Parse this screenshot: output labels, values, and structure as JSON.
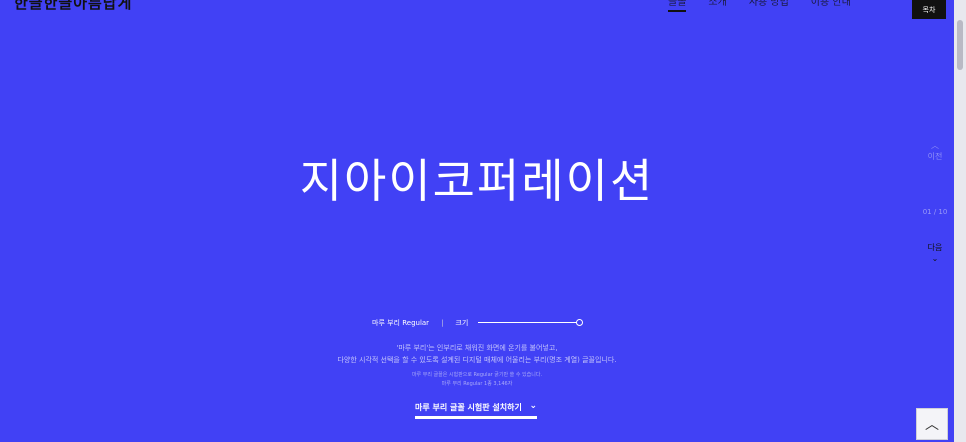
{
  "logo": "한글한글아름답게",
  "nav": [
    "글꼴",
    "소개",
    "사용 방법",
    "이용 안내"
  ],
  "toc_label": "목차",
  "headline": "지아이코퍼레이션",
  "side_up": {
    "arrow": "^",
    "label": "이전"
  },
  "counter": "01 / 10",
  "side_down": {
    "label": "다음",
    "arrow": "v"
  },
  "controls": {
    "font_name": "마루 부리 Regular",
    "separator": "|",
    "size_label": "크기",
    "size_value": 1.0
  },
  "description": {
    "line1": "'마루 부리'는 인부리로 채워진 화면에 온기를 불어넣고,",
    "line2": "다양한 시각적 선택을 할 수 있도록 설계된 디지털 매체에 어울리는 부리(명조 계열) 글꼴입니다.",
    "line3": "마루 부리 글꼴은 시험판으로 Regular 굵기만 쓸 수 있습니다.",
    "line4": "마루 부리 Regular 1종 3,146자"
  },
  "install_button": "마루 부리 글꼴 시험판 설치하기",
  "top_button_icon": "chevron-up-icon"
}
